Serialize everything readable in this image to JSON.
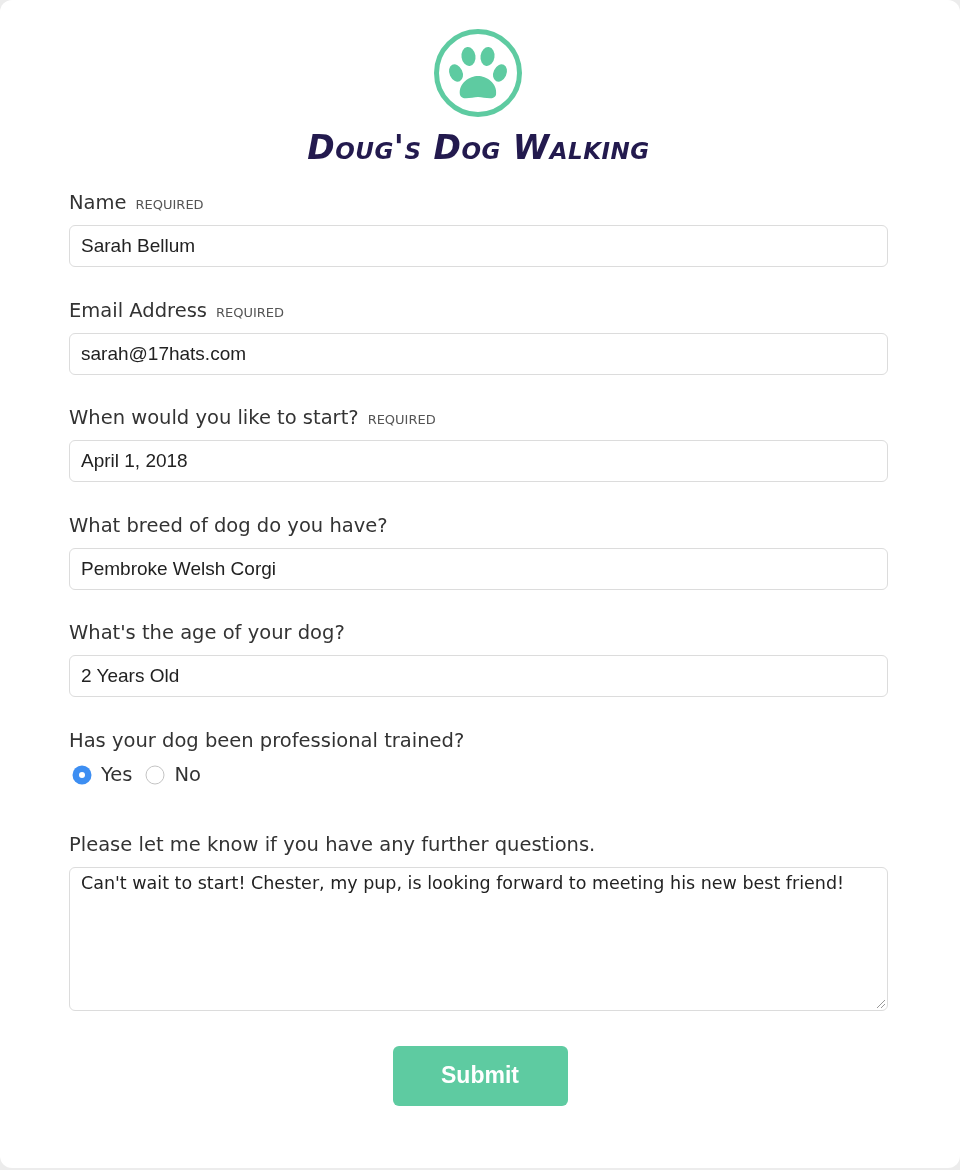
{
  "header": {
    "title": "Doug's Dog Walking"
  },
  "fields": [
    {
      "kind": "text",
      "label": "Name",
      "tag": "REQUIRED",
      "value": "Sarah Bellum"
    },
    {
      "kind": "text",
      "label": "Email Address",
      "tag": "REQUIRED",
      "value": "sarah@17hats.com"
    },
    {
      "kind": "text",
      "label": "When would you like to start?",
      "tag": "REQUIRED",
      "value": "April 1, 2018"
    },
    {
      "kind": "text",
      "label": "What breed of dog do you have?",
      "value": "Pembroke Welsh Corgi"
    },
    {
      "kind": "text",
      "label": "What's the age of your dog?",
      "value": "2 Years Old"
    },
    {
      "kind": "radio",
      "label": "Has your dog been professional trained?",
      "options": [
        {
          "label": "Yes",
          "selected": true
        },
        {
          "label": "No",
          "selected": false
        }
      ]
    },
    {
      "kind": "textarea",
      "label": "Please let me know if you have any further questions.",
      "value": "Can't wait to start! Chester, my pup, is looking forward to meeting his new best friend!"
    }
  ],
  "submit": {
    "label": "Submit"
  }
}
